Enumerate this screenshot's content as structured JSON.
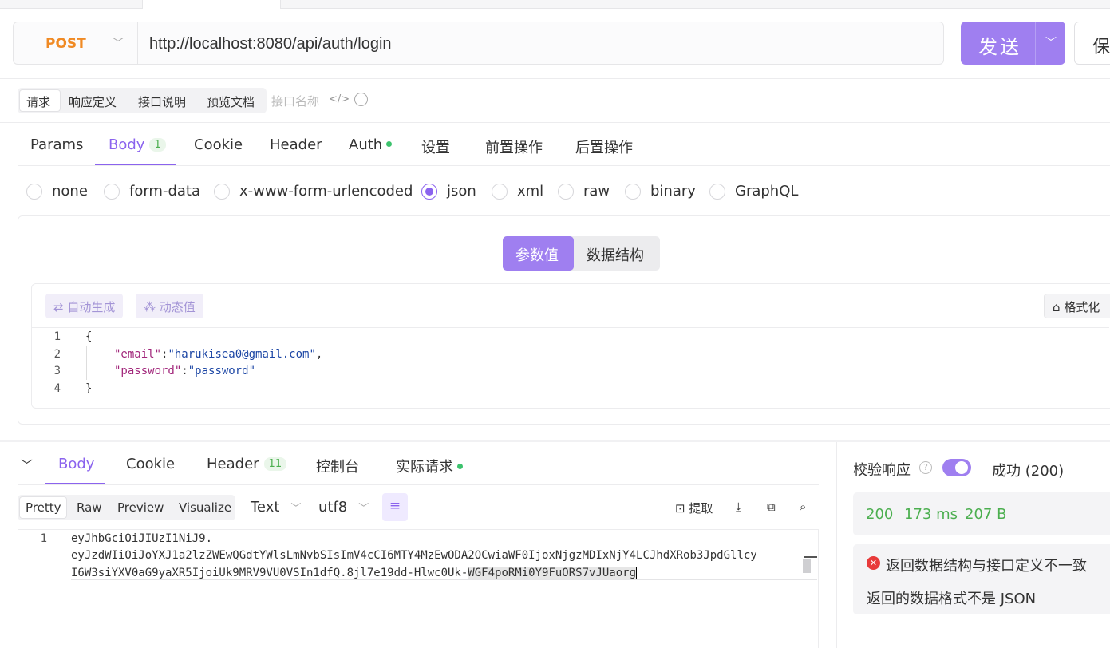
{
  "request": {
    "method": "POST",
    "url": "http://localhost:8080/api/auth/login",
    "send_label": "发送",
    "save_label": "保"
  },
  "segments": [
    "请求",
    "响应定义",
    "接口说明",
    "预览文档"
  ],
  "interface_name_placeholder": "接口名称",
  "request_tabs": {
    "params": "Params",
    "body": "Body",
    "body_count": "1",
    "cookie": "Cookie",
    "header": "Header",
    "auth": "Auth",
    "settings": "设置",
    "pre_ops": "前置操作",
    "post_ops": "后置操作"
  },
  "body_types": [
    "none",
    "form-data",
    "x-www-form-urlencoded",
    "json",
    "xml",
    "raw",
    "binary",
    "GraphQL"
  ],
  "body_type_selected": "json",
  "value_toggle": {
    "values": "参数值",
    "schema": "数据结构"
  },
  "editor_tools": {
    "auto_generate": "自动生成",
    "dynamic_value": "动态值",
    "format": "格式化"
  },
  "request_body": {
    "line_numbers": [
      "1",
      "2",
      "3",
      "4"
    ],
    "open": "{",
    "email_key": "\"email\"",
    "email_value": "\"harukisea0@gmail.com\"",
    "password_key": "\"password\"",
    "password_value": "\"password\"",
    "close": "}"
  },
  "response_tabs": {
    "body": "Body",
    "cookie": "Cookie",
    "header": "Header",
    "header_count": "11",
    "console": "控制台",
    "actual_request": "实际请求"
  },
  "view_modes": [
    "Pretty",
    "Raw",
    "Preview",
    "Visualize"
  ],
  "format_select": "Text",
  "encoding_select": "utf8",
  "extract_label": "提取",
  "response_body": {
    "line_number": "1",
    "line1": "eyJhbGciOiJIUzI1NiJ9.",
    "line2": "eyJzdWIiOiJoYXJ1a2lzZWEwQGdtYWlsLmNvbSIsImV4cCI6MTY4MzEwODA2OCwiaWF0IjoxNjgzMDIxNjY4LCJhdXRob3JpdGllcy",
    "line3_plain": "I6W3siYXV0aG9yaXR5IjoiUk9MRV9VU0VSIn1dfQ.8jl7e19dd-Hlwc0Uk-",
    "line3_selected": "WGF4poRMi0Y9FuORS7vJUaorg"
  },
  "validation": {
    "title": "校验响应",
    "result": "成功 (200)",
    "status": "200",
    "time": "173 ms",
    "size": "207 B",
    "error_title": "返回数据结构与接口定义不一致",
    "error_detail": "返回的数据格式不是 JSON"
  },
  "colors": {
    "accent": "#9f7ff0",
    "method": "#f08a24",
    "success": "#4caf50",
    "error": "#e83a3a"
  }
}
